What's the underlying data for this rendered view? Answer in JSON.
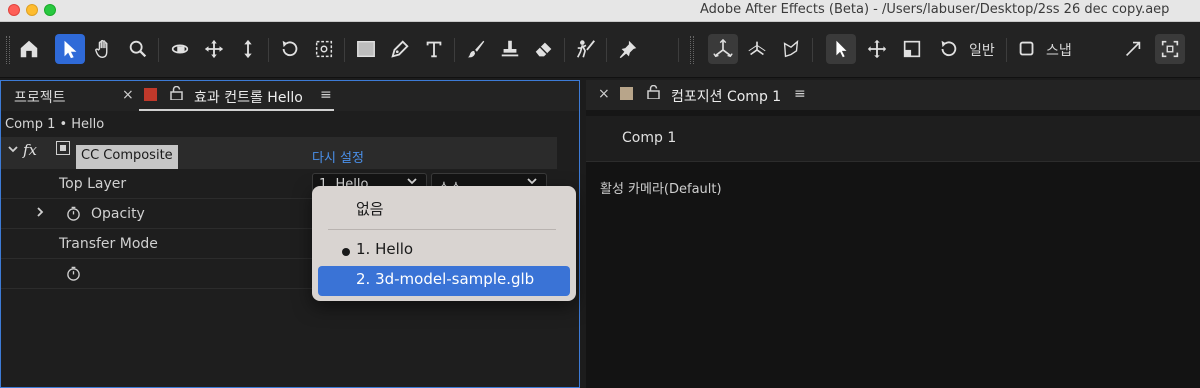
{
  "window": {
    "title": "Adobe After Effects (Beta) - /Users/labuser/Desktop/2ss 26 dec copy.aep"
  },
  "toolbar": {
    "tools": [
      "home-icon",
      "selection-arrow-icon",
      "hand-icon",
      "zoom-icon",
      "orbit-camera-icon",
      "pan-camera-icon",
      "dolly-camera-icon",
      "rotate-icon",
      "anchor-point-icon",
      "rectangle-icon",
      "pen-icon",
      "type-icon",
      "brush-icon",
      "clone-stamp-icon",
      "eraser-icon",
      "roto-brush-icon",
      "puppet-pin-icon"
    ],
    "right_tools": [
      "universal-axis-icon",
      "local-axis-icon",
      "view-axis-icon",
      "select-icon",
      "move-icon",
      "scale-icon",
      "rotate-icon"
    ],
    "general_label": "일반",
    "snap_label": "스냅"
  },
  "left_panel": {
    "project_tab": "프로젝트",
    "effects_tab": "효과 컨트롤 Hello",
    "tab_close": "×",
    "tab_menu": "≡",
    "effects_tab_swatch_color": "#c0392b",
    "breadcrumb": "Comp 1 • Hello",
    "effect": {
      "fx_label": "fx",
      "name": "CC Composite",
      "reset": "다시 설정"
    },
    "properties": {
      "top_layer": "Top Layer",
      "top_layer_value": "1. Hello",
      "source_value": "소스",
      "opacity": "Opacity",
      "transfer_mode": "Transfer Mode"
    }
  },
  "dropdown": {
    "none_option": "없음",
    "options": [
      "1. Hello",
      "2. 3d-model-sample.glb"
    ],
    "checked": "1. Hello",
    "highlighted": "2. 3d-model-sample.glb"
  },
  "right_panel": {
    "comp_tab": "컴포지션 Comp 1",
    "tab_close": "×",
    "tab_menu": "≡",
    "swatch_color": "#b8a58a",
    "comp_subtab": "Comp 1",
    "camera": "활성 카메라(Default)"
  }
}
